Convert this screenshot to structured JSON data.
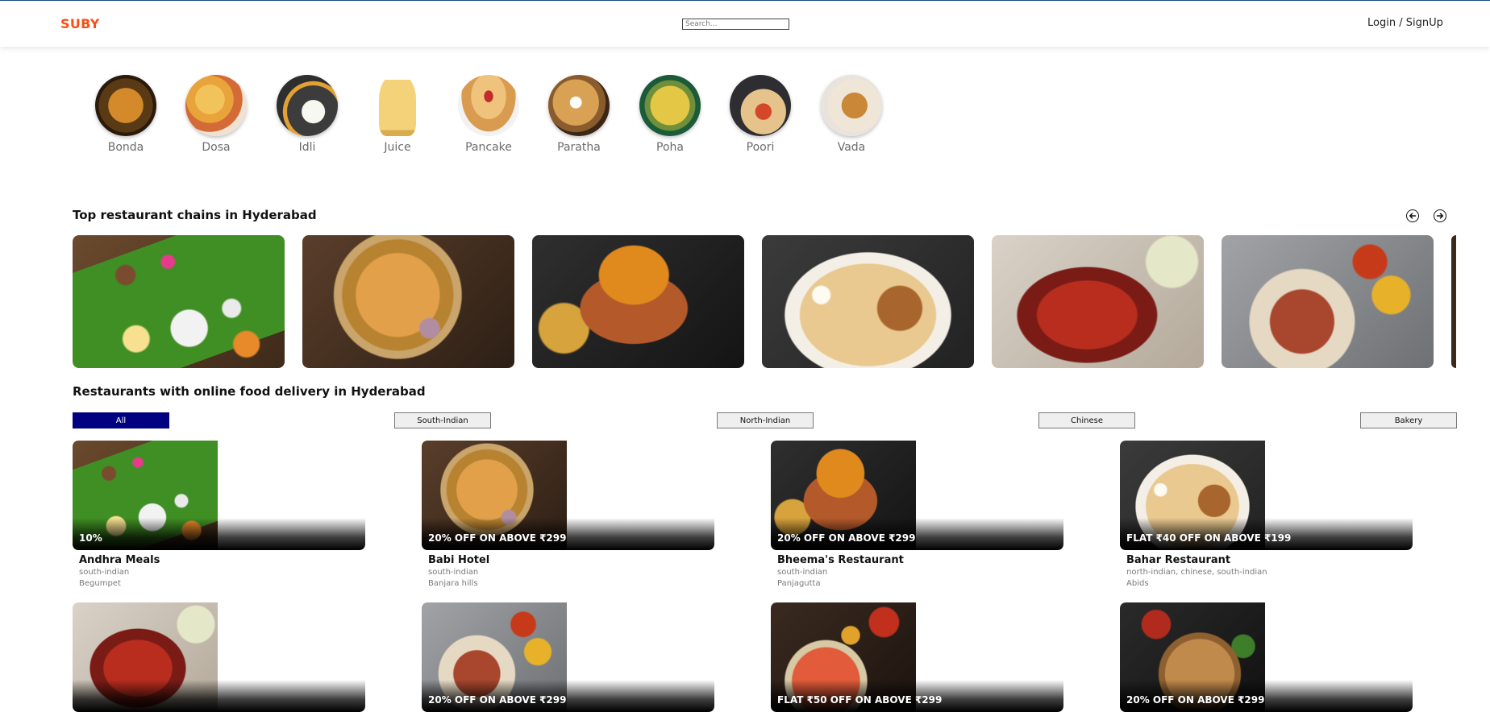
{
  "header": {
    "logo": "SUBY",
    "search_placeholder": "Search...",
    "login": "Login / SignUp"
  },
  "categories": [
    {
      "label": "Bonda",
      "icon": "bonda-icon"
    },
    {
      "label": "Dosa",
      "icon": "dosa-icon"
    },
    {
      "label": "Idli",
      "icon": "idli-icon"
    },
    {
      "label": "Juice",
      "icon": "juice-icon"
    },
    {
      "label": "Pancake",
      "icon": "pancake-icon"
    },
    {
      "label": "Paratha",
      "icon": "paratha-icon"
    },
    {
      "label": "Poha",
      "icon": "poha-icon"
    },
    {
      "label": "Poori",
      "icon": "poori-icon"
    },
    {
      "label": "Vada",
      "icon": "vada-icon"
    }
  ],
  "top_chains": {
    "heading": "Top restaurant chains in Hyderabad",
    "prev_icon": "arrow-left-circle-icon",
    "next_icon": "arrow-right-circle-icon",
    "images": [
      "thali-image",
      "biryani-image",
      "curry-bucket-image",
      "chicken-biryani-image",
      "tandoori-chicken-image",
      "chilli-chicken-image"
    ]
  },
  "delivery": {
    "heading": "Restaurants with online food delivery in Hyderabad",
    "filters": [
      "All",
      "South-Indian",
      "North-Indian",
      "Chinese",
      "Bakery"
    ],
    "active_filter": "All",
    "restaurants": [
      {
        "name": "Andhra Meals",
        "cuisine": "south-indian",
        "area": "Begumpet",
        "offer": "10%"
      },
      {
        "name": "Babi Hotel",
        "cuisine": "south-indian",
        "area": "Banjara hills",
        "offer": "20% OFF ON ABOVE ₹299"
      },
      {
        "name": "Bheema's Restaurant",
        "cuisine": "south-indian",
        "area": "Panjagutta",
        "offer": "20% OFF ON ABOVE ₹299"
      },
      {
        "name": "Bahar Restaurant",
        "cuisine": "north-indian, chinese, south-indian",
        "area": "Abids",
        "offer": "FLAT ₹40 OFF ON ABOVE ₹199"
      },
      {
        "name": "",
        "cuisine": "",
        "area": "",
        "offer": ""
      },
      {
        "name": "",
        "cuisine": "",
        "area": "",
        "offer": "20% OFF ON ABOVE ₹299"
      },
      {
        "name": "",
        "cuisine": "",
        "area": "",
        "offer": "FLAT ₹50 OFF ON ABOVE ₹299"
      },
      {
        "name": "",
        "cuisine": "",
        "area": "",
        "offer": "20% OFF ON ABOVE ₹299"
      }
    ]
  },
  "colors": {
    "brand": "#fc4d12",
    "active_filter": "#000080"
  }
}
